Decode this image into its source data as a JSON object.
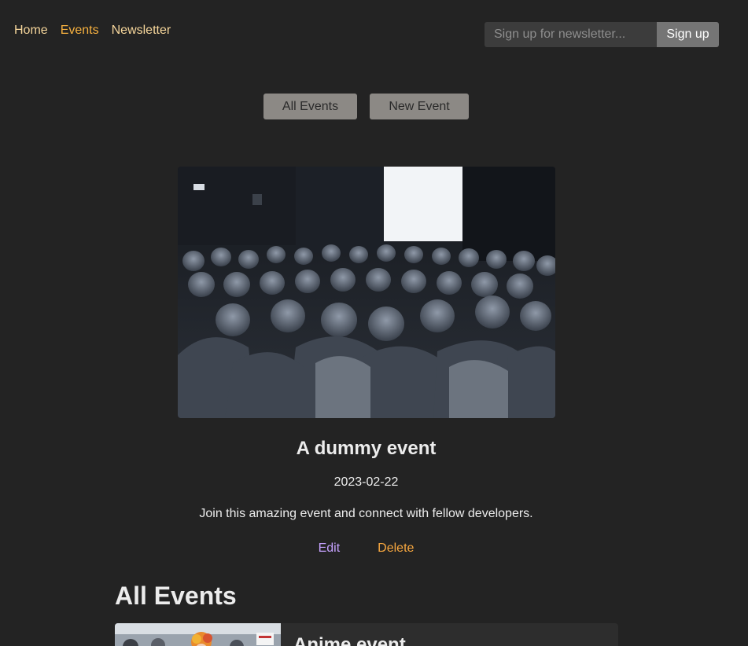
{
  "nav": {
    "home": "Home",
    "events": "Events",
    "newsletter": "Newsletter"
  },
  "newsletter_form": {
    "placeholder": "Sign up for newsletter...",
    "submit_label": "Sign up"
  },
  "event_nav": {
    "all_label": "All Events",
    "new_label": "New Event"
  },
  "event": {
    "title": "A dummy event",
    "date": "2023-02-22",
    "description": "Join this amazing event and connect with fellow developers.",
    "edit_label": "Edit",
    "delete_label": "Delete"
  },
  "events_list": {
    "heading": "All Events",
    "items": [
      {
        "title": "Anime event"
      }
    ]
  },
  "colors": {
    "background": "#232323",
    "nav_link": "#f6d69b",
    "nav_active": "#f7b13f",
    "edit_link": "#c6a2ff",
    "delete_link": "#f7a73f",
    "button_bg": "#8c8985"
  }
}
